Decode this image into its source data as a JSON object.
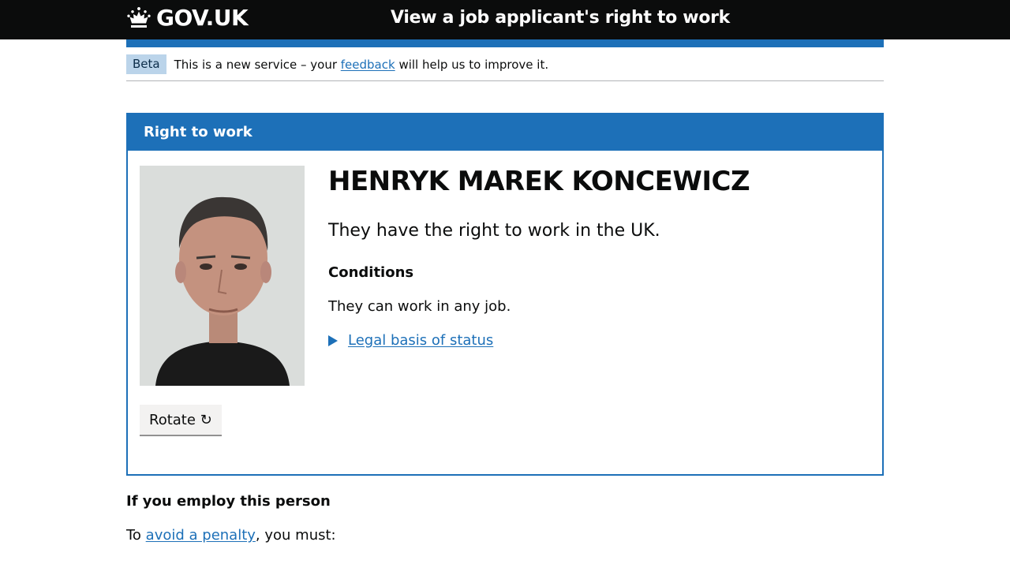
{
  "header": {
    "logo_text": "GOV.UK",
    "service_name": "View a job applicant's right to work"
  },
  "phase_banner": {
    "tag": "Beta",
    "text_before": "This is a new service – your ",
    "link": "feedback",
    "text_after": " will help us to improve it."
  },
  "panel": {
    "title": "Right to work",
    "person_name": "HENRYK MAREK KONCEWICZ",
    "status": "They have the right to work in the UK.",
    "conditions_heading": "Conditions",
    "conditions_text": "They can work in any job.",
    "details_link": "Legal basis of status",
    "rotate_button": "Rotate ↻"
  },
  "employ": {
    "heading": "If you employ this person",
    "text_before": "To ",
    "link": "avoid a penalty",
    "text_after": ", you must:"
  },
  "colors": {
    "header_bg": "#0b0c0c",
    "brand_blue": "#1d70b8",
    "beta_tag_bg": "#bbd4ea"
  }
}
